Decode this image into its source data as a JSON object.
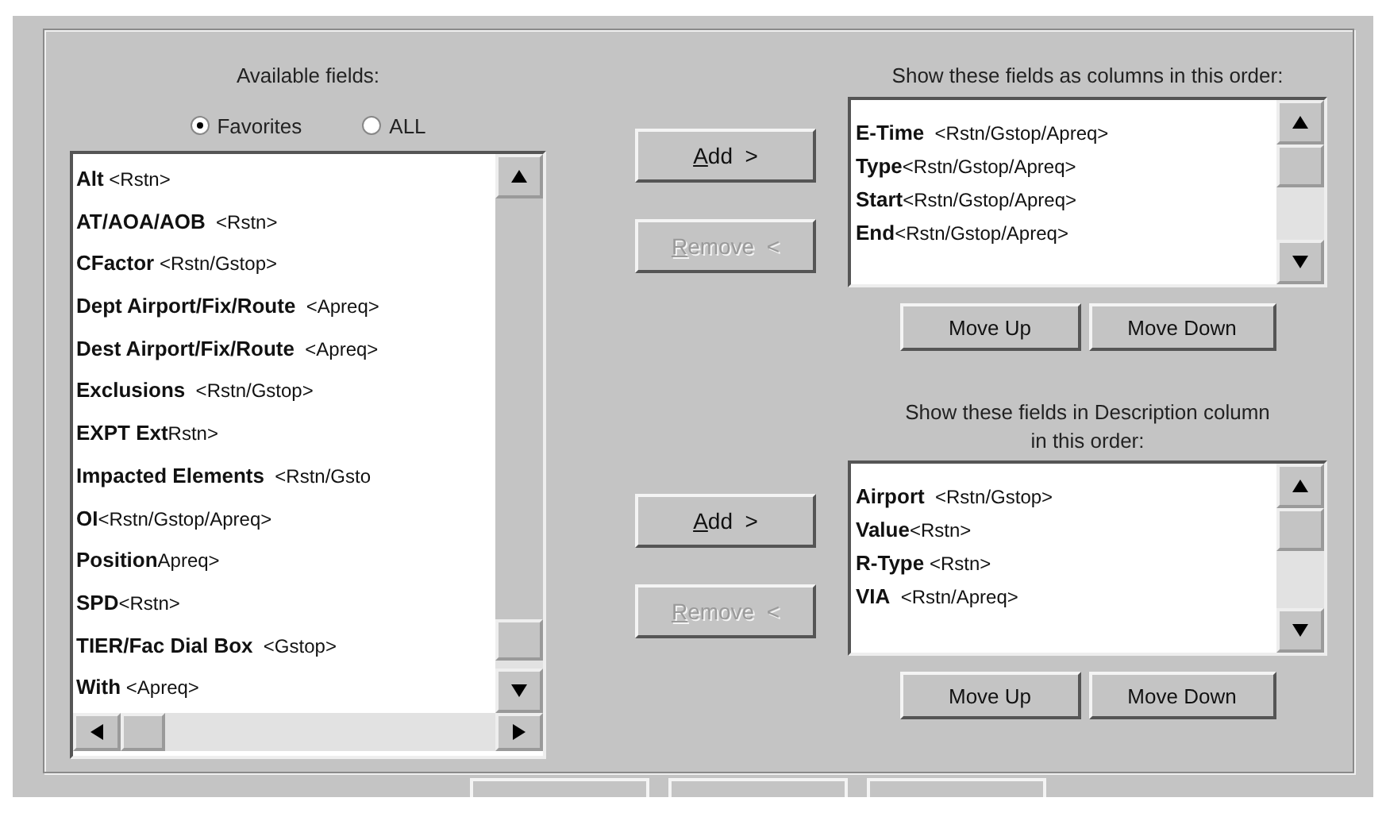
{
  "available": {
    "title": "Available fields:",
    "filters": [
      {
        "label": "Favorites",
        "selected": true
      },
      {
        "label": "ALL",
        "selected": false
      }
    ],
    "items": [
      "**Alt** <Rstn>",
      "**AT/AOA/AOB**  <Rstn>",
      "**CFactor** <Rstn/Gstop>",
      "**Dept Airport/Fix/Route**  <Apreq>",
      "**Dest Airport/Fix/Route**  <Apreq>",
      "**Exclusions**  <Rstn/Gstop>",
      "**EXPT Ext**Rstn>",
      "**Impacted Elements**  <Rstn/Gsto",
      "**OI**<Rstn/Gstop/Apreq>",
      "**Position**Apreq>",
      "**SPD**<Rstn>",
      "**TIER/Fac Dial Box**  <Gstop>",
      "**With** <Apreq>"
    ]
  },
  "groups": [
    {
      "title": "Show these fields as columns in this order:",
      "add": {
        "label": "Add  >",
        "disabled": false
      },
      "remove": {
        "label": "Remove  <",
        "disabled": true
      },
      "items": [
        "**E-Time**  <Rstn/Gstop/Apreq>",
        "**Type**<Rstn/Gstop/Apreq>",
        "**Start**<Rstn/Gstop/Apreq>",
        "**End**<Rstn/Gstop/Apreq>"
      ],
      "move_up": "Move Up",
      "move_down": "Move Down"
    },
    {
      "title": "Show these fields in Description column\nin this order:",
      "add": {
        "label": "Add  >",
        "disabled": false
      },
      "remove": {
        "label": "Remove  <",
        "disabled": true
      },
      "items": [
        "**Airport**  <Rstn/Gstop>",
        "**Value**<Rstn>",
        "**R-Type** <Rstn>",
        "**VIA**  <Rstn/Apreq>"
      ],
      "move_up": "Move Up",
      "move_down": "Move Down"
    }
  ]
}
